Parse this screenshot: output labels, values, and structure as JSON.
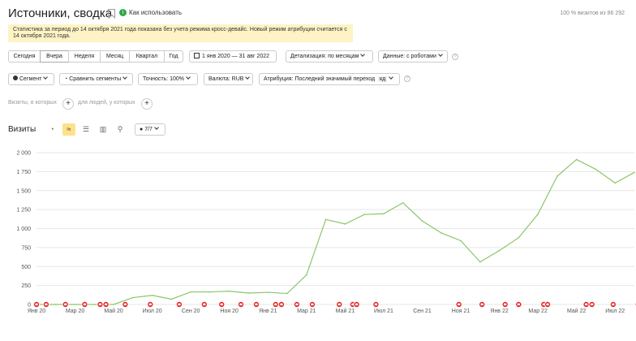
{
  "header": {
    "title": "Источники, сводка",
    "howto_label": "Как использовать",
    "visits_total": "100 % визитов из 86 292"
  },
  "notice": {
    "text": "Статистика за период до 14 октября 2021 года показана без учета режима кросс-девайс. Новый режим атрибуции считается с 14 октября 2021 года."
  },
  "period": {
    "presets": [
      "Сегодня",
      "Вчера",
      "Неделя",
      "Месяц",
      "Квартал",
      "Год"
    ],
    "date_range": "1 янв 2020 — 31 авг 2022",
    "detail_label": "Детализация: по месяцам",
    "data_label": "Данные: с роботами"
  },
  "toolbar": {
    "segment_label": "Сегмент",
    "compare_label": "Сравнить сегменты",
    "accuracy_label": "Точность: 100%",
    "currency_label": "Валюта: RUB",
    "attribution_label": "Атрибуция: Последний значимый переход",
    "attribution_badge": "кд"
  },
  "filters": {
    "visits_label": "Визиты, в которых",
    "people_label": "для людей, у которых"
  },
  "metric": {
    "title": "Визиты",
    "series_count": "7/7"
  },
  "colors": {
    "line": "#8cc56a",
    "marker": "#e52a2a",
    "grid": "#e6e6e6",
    "notice_bg": "#fdf3c4",
    "active_view": "#ffe18a"
  },
  "chart_data": {
    "type": "line",
    "ylim": [
      0,
      2000
    ],
    "y_ticks": [
      "0",
      "250",
      "500",
      "750",
      "1 000",
      "1 250",
      "1 500",
      "1 750",
      "2 000"
    ],
    "x_tick_labels": [
      "Янв 20",
      "Мар 20",
      "Май 20",
      "Июл 20",
      "Сен 20",
      "Ноя 20",
      "Янв 21",
      "Мар 21",
      "Май 21",
      "Июл 21",
      "Сен 21",
      "Ноя 21",
      "Янв 22",
      "Мар 22",
      "Май 22",
      "Июл 22"
    ],
    "months": [
      "2020-01",
      "2020-02",
      "2020-03",
      "2020-04",
      "2020-05",
      "2020-06",
      "2020-07",
      "2020-08",
      "2020-09",
      "2020-10",
      "2020-11",
      "2020-12",
      "2021-01",
      "2021-02",
      "2021-03",
      "2021-04",
      "2021-05",
      "2021-06",
      "2021-07",
      "2021-08",
      "2021-09",
      "2021-10",
      "2021-11",
      "2021-12",
      "2022-01",
      "2022-02",
      "2022-03",
      "2022-04",
      "2022-05",
      "2022-06",
      "2022-07",
      "2022-08"
    ],
    "values": [
      0,
      0,
      0,
      0,
      0,
      90,
      120,
      70,
      165,
      165,
      175,
      150,
      160,
      145,
      390,
      1120,
      1060,
      1185,
      1195,
      1340,
      1100,
      940,
      840,
      560,
      710,
      880,
      1190,
      1690,
      1910,
      1780,
      1600,
      1740
    ],
    "annotation_months": [
      0,
      0.5,
      1.5,
      2.5,
      3.3,
      3.6,
      4.6,
      5.9,
      7.4,
      8.7,
      9.6,
      10.6,
      11.4,
      12.4,
      12.7,
      13.5,
      14.3,
      15.7,
      16.4,
      16.6,
      17.6,
      21.9,
      23.1,
      24.3,
      25,
      26.3,
      26.5,
      28.5,
      28.8,
      29.9,
      31.2
    ]
  }
}
